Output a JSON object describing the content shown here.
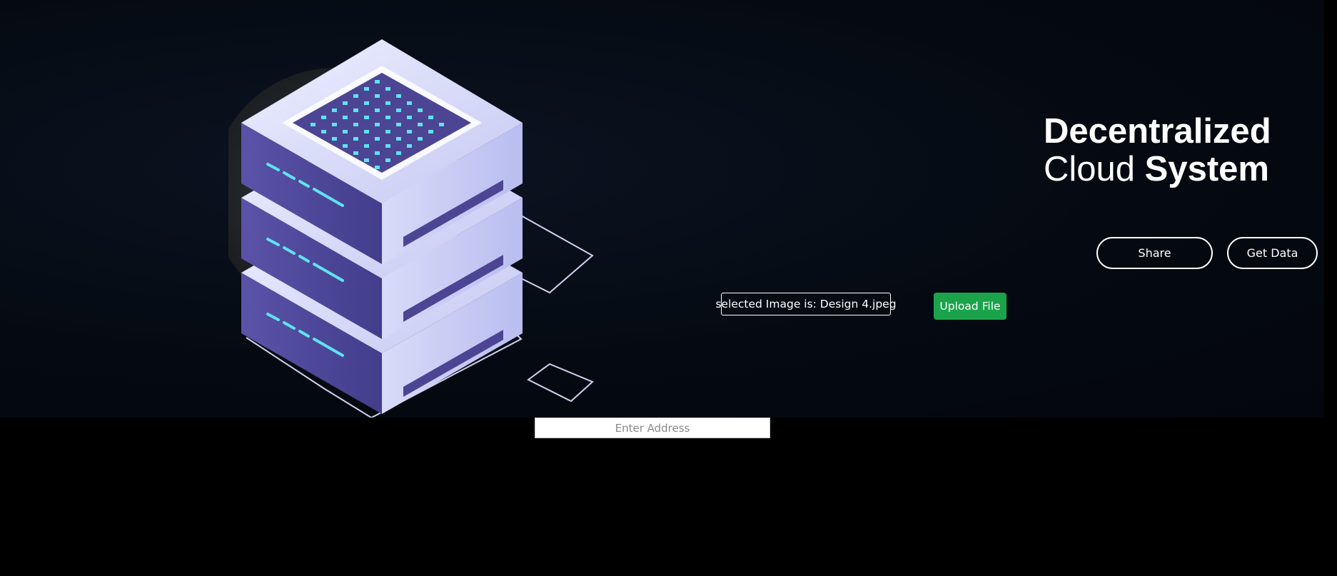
{
  "hero": {
    "title_line1": "Decentralized",
    "title_line2_light": "Cloud",
    "title_line2_bold": "System"
  },
  "actions": {
    "share_label": "Share",
    "get_data_label": "Get Data"
  },
  "upload": {
    "file_label": "selected Image is: Design 4.jpeg",
    "upload_label": "Upload File"
  },
  "address": {
    "placeholder": "Enter Address",
    "value": ""
  },
  "colors": {
    "background": "#000000",
    "hero_background": "#050a12",
    "upload_button": "#1aa34a",
    "server_face": "#d9dcf7",
    "server_side": "#4b4594",
    "led": "#5fe3f0"
  },
  "illustration": {
    "name": "isometric-server-stack-icon"
  }
}
